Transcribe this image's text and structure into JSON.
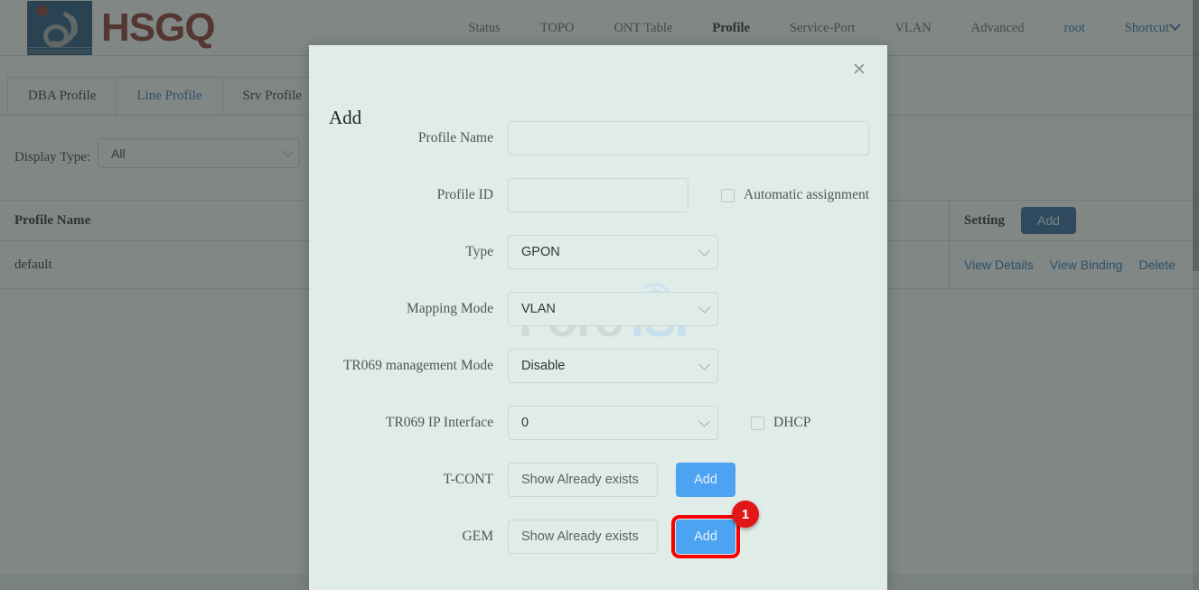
{
  "brand": {
    "name": "HSGQ",
    "logo_icon": "hsgq-logo-icon"
  },
  "topnav": {
    "items": [
      {
        "label": "Status",
        "active": false
      },
      {
        "label": "TOPO",
        "active": false
      },
      {
        "label": "ONT Table",
        "active": false
      },
      {
        "label": "Profile",
        "active": true
      },
      {
        "label": "Service-Port",
        "active": false
      },
      {
        "label": "VLAN",
        "active": false
      },
      {
        "label": "Advanced",
        "active": false
      }
    ],
    "user": "root",
    "shortcut": "Shortcut",
    "shortcut_icon": "chevron-down-icon"
  },
  "tabs": [
    {
      "label": "DBA Profile",
      "active": false
    },
    {
      "label": "Line Profile",
      "active": true
    },
    {
      "label": "Srv Profile",
      "active": false
    }
  ],
  "filter": {
    "label": "Display Type:",
    "value": "All",
    "caret_icon": "chevron-down-icon"
  },
  "table": {
    "columns": [
      "Profile Name",
      "Setting"
    ],
    "header_add_label": "Add",
    "rows": [
      {
        "profile_name": "default",
        "actions": [
          "View Details",
          "View Binding",
          "Delete"
        ]
      }
    ]
  },
  "watermark": {
    "part1": "Foro",
    "part2": "ISP"
  },
  "modal": {
    "title": "Add",
    "close_icon": "close-icon",
    "fields": {
      "profile_name": {
        "label": "Profile Name",
        "value": "",
        "placeholder": ""
      },
      "profile_id": {
        "label": "Profile ID",
        "value": "",
        "placeholder": ""
      },
      "automatic_assignment": {
        "label": "Automatic assignment",
        "checked": false
      },
      "type": {
        "label": "Type",
        "value": "GPON",
        "caret_icon": "chevron-down-icon"
      },
      "mapping_mode": {
        "label": "Mapping Mode",
        "value": "VLAN",
        "caret_icon": "chevron-down-icon"
      },
      "tr069_management_mode": {
        "label": "TR069 management Mode",
        "value": "Disable",
        "caret_icon": "chevron-down-icon"
      },
      "tr069_ip_interface": {
        "label": "TR069 IP Interface",
        "value": "0",
        "caret_icon": "chevron-down-icon"
      },
      "dhcp": {
        "label": "DHCP",
        "checked": false
      },
      "tcont": {
        "label": "T-CONT",
        "show_label": "Show Already exists",
        "add_label": "Add"
      },
      "gem": {
        "label": "GEM",
        "show_label": "Show Already exists",
        "add_label": "Add"
      }
    }
  },
  "annotation": {
    "step_number": "1",
    "highlight_color": "#fb0000"
  }
}
